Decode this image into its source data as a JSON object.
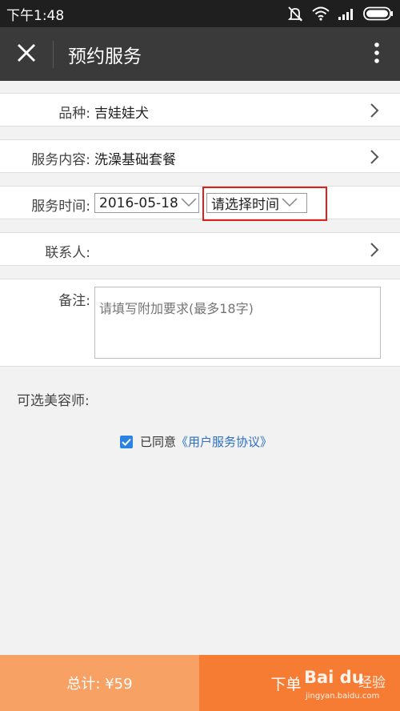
{
  "status_bar": {
    "time": "下午1:48",
    "icons": [
      "mute-icon",
      "wifi-icon",
      "signal-icon",
      "battery-icon"
    ]
  },
  "app_bar": {
    "title": "预约服务",
    "icons": [
      "close-icon",
      "more-vertical-icon"
    ]
  },
  "form": {
    "breed": {
      "label": "品种:",
      "value": "吉娃娃犬"
    },
    "service_content": {
      "label": "服务内容:",
      "value": "洗澡基础套餐"
    },
    "service_time": {
      "label": "服务时间:",
      "date_value": "2016-05-18",
      "time_value": "请选择时间"
    },
    "contact": {
      "label": "联系人:",
      "value": ""
    },
    "remark": {
      "label": "备注:",
      "placeholder": "请填写附加要求(最多18字)"
    }
  },
  "stylist": {
    "label": "可选美容师:"
  },
  "agreement": {
    "checked": true,
    "text": "已同意",
    "link": "《用户服务协议》"
  },
  "bottom_bar": {
    "total": "总计: ¥59",
    "order_button": "下单"
  },
  "watermark": {
    "logo": "Bai du",
    "logo_cn": "经验",
    "url": "jingyan.baidu.com"
  },
  "colors": {
    "status_bar": "#1f1f1f",
    "app_bar": "#3a3a3a",
    "total_bar": "#f7a264",
    "order_button": "#f67c34",
    "highlight_box": "#e0201a",
    "checkbox": "#2b84e3",
    "link": "#2b6fc6"
  }
}
